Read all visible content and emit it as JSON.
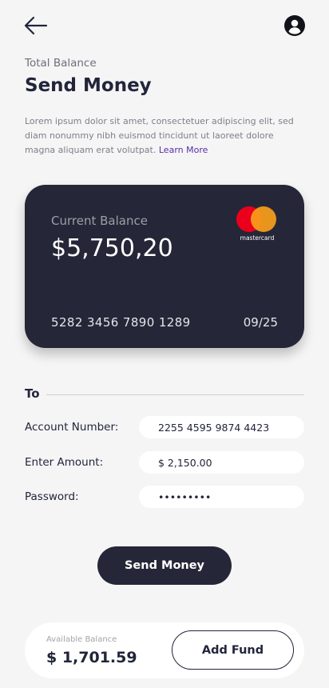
{
  "header": {
    "back_icon": "arrow-left-icon",
    "profile_icon": "user-circle-icon"
  },
  "page": {
    "subtitle": "Total Balance",
    "title": "Send Money",
    "description": "Lorem ipsum dolor sit amet, consectetuer adipiscing elit, sed diam nonummy nibh euismod tincidunt ut laoreet dolore magna aliquam erat volutpat.",
    "learn_more": "Learn More"
  },
  "card": {
    "label": "Current Balance",
    "balance": "$5,750,20",
    "brand": "mastercard",
    "number": "5282 3456 7890 1289",
    "expiry": "09/25",
    "colors": {
      "background": "#252738",
      "mc_red": "#eb001b",
      "mc_orange": "#f79e1b"
    }
  },
  "form": {
    "section_label": "To",
    "fields": [
      {
        "label": "Account Number:",
        "value": "2255 4595 9874 4423"
      },
      {
        "label": "Enter Amount:",
        "value": "$ 2,150.00"
      },
      {
        "label": "Password:",
        "value": "•••••••••"
      }
    ]
  },
  "actions": {
    "send_label": "Send Money"
  },
  "footer": {
    "available_label": "Available Balance",
    "available_value": "$ 1,701.59",
    "add_fund_label": "Add Fund"
  }
}
